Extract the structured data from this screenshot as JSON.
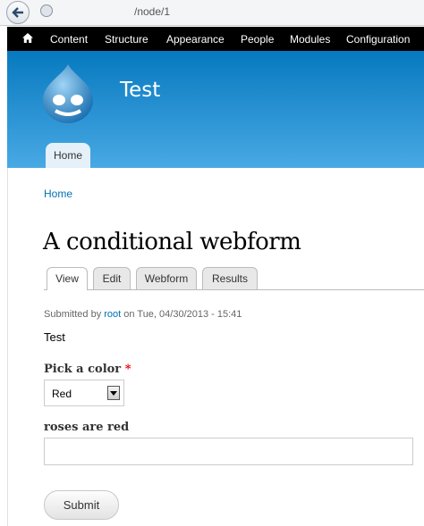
{
  "browser": {
    "url": "/node/1"
  },
  "toolbar": {
    "items": [
      "Content",
      "Structure",
      "Appearance",
      "People",
      "Modules",
      "Configuration"
    ]
  },
  "header": {
    "site_name": "Test",
    "tab_home": "Home"
  },
  "breadcrumb": "Home",
  "page": {
    "title": "A conditional webform"
  },
  "tabs": [
    {
      "label": "View",
      "active": true
    },
    {
      "label": "Edit",
      "active": false
    },
    {
      "label": "Webform",
      "active": false
    },
    {
      "label": "Results",
      "active": false
    }
  ],
  "submitted": {
    "prefix": "Submitted by ",
    "user": "root",
    "suffix": " on Tue, 04/30/2013 - 15:41"
  },
  "body": "Test",
  "form": {
    "color_label": "Pick a color",
    "required_mark": "*",
    "color_value": "Red",
    "text_label": "roses are red",
    "text_value": "",
    "submit_label": "Submit"
  },
  "colors": {
    "toolbar": "#000000",
    "header_top": "#0779bf",
    "header_bottom": "#48a9e4",
    "link": "#0071b3"
  }
}
